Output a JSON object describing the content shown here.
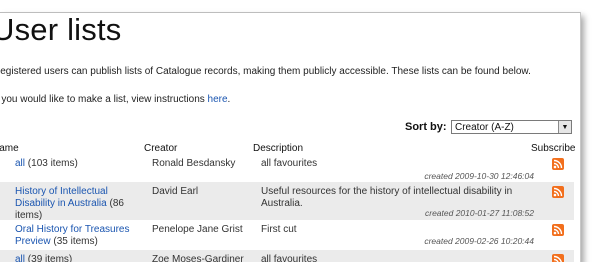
{
  "page": {
    "title": "User lists",
    "intro": "Registered users can publish lists of Catalogue records, making them publicly accessible. These lists can be found below.",
    "howto_prefix": "If you would like to make a list, view instructions ",
    "howto_link": "here",
    "howto_suffix": "."
  },
  "sort": {
    "label": "Sort by:",
    "selected": "Creator (A-Z)"
  },
  "table": {
    "headers": {
      "name": "Name",
      "creator": "Creator",
      "description": "Description",
      "subscribe": "Subscribe"
    },
    "rows": [
      {
        "name": "all",
        "count": "(103 items)",
        "creator": "Ronald Besdansky",
        "description": "all favourites",
        "created": "created 2009-10-30 12:46:04"
      },
      {
        "name": "History of Intellectual Disability in Australia",
        "count": "(86 items)",
        "creator": "David Earl",
        "description": "Useful resources for the history of intellectual disability in Australia.",
        "created": "created 2010-01-27 11:08:52"
      },
      {
        "name": "Oral History for Treasures Preview",
        "count": "(35 items)",
        "creator": "Penelope Jane Grist",
        "description": "First cut",
        "created": "created 2009-02-26 10:20:44"
      },
      {
        "name": "all",
        "count": "(39 items)",
        "creator": "Zoe Moses-Gardiner",
        "description": "all favourites",
        "created": ""
      }
    ]
  },
  "colors": {
    "link": "#1a55b0",
    "row_alt": "#ebebeb",
    "rss": "#f26f1d"
  },
  "icons": {
    "subscribe": "rss-feed-icon",
    "dropdown": "chevron-down-icon"
  }
}
